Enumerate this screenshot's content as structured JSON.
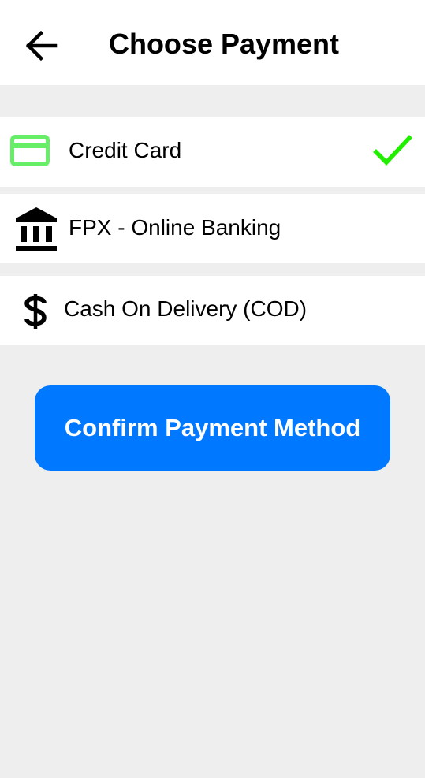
{
  "header": {
    "title": "Choose Payment",
    "back_icon": "arrow-left-icon"
  },
  "payment_options": [
    {
      "label": "Credit Card",
      "icon": "credit-card-icon",
      "icon_color": "#66ee66",
      "selected": true
    },
    {
      "label": "FPX - Online Banking",
      "icon": "bank-icon",
      "icon_color": "#000000",
      "selected": false
    },
    {
      "label": "Cash On Delivery (COD)",
      "icon": "dollar-icon",
      "icon_color": "#000000",
      "selected": false
    }
  ],
  "selected_check": {
    "icon": "checkmark-icon",
    "color": "#22ee00"
  },
  "confirm_button": {
    "label": "Confirm Payment Method",
    "color": "#0078ff"
  }
}
